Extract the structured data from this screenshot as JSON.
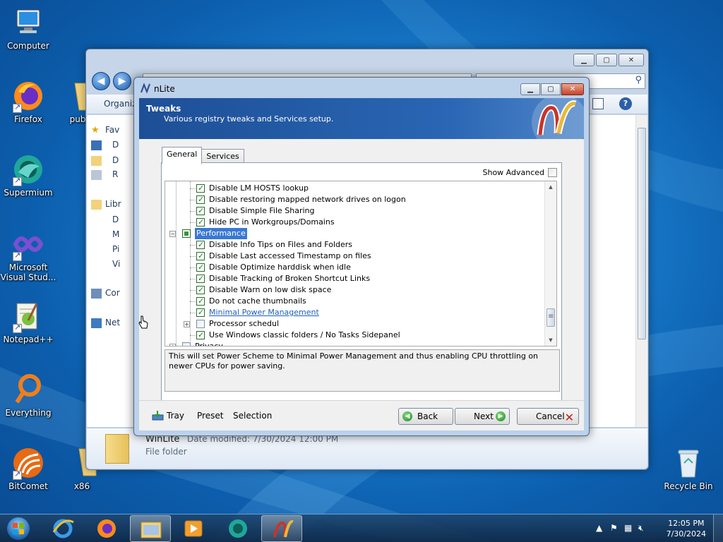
{
  "desktop": {
    "icons": [
      {
        "label": "Computer"
      },
      {
        "label": "Firefox"
      },
      {
        "label": "Supermium"
      },
      {
        "label": "Microsoft Visual Stud..."
      },
      {
        "label": "Notepad++"
      },
      {
        "label": "Everything"
      },
      {
        "label": "BitComet"
      },
      {
        "label": "Recycle Bin"
      },
      {
        "label": "pub"
      },
      {
        "label": "x86"
      }
    ]
  },
  "explorer": {
    "toolbar_organize": "Organiz",
    "nav": {
      "favorites": "Fav",
      "item_d1": "D",
      "item_d2": "D",
      "item_r": "R",
      "libraries": "Libr",
      "lib_d": "D",
      "lib_m": "M",
      "lib_p": "Pi",
      "lib_v": "Vi",
      "computer": "Cor",
      "network": "Net"
    },
    "detail": {
      "name": "WinLite",
      "modified": "Date modified:  7/30/2024 12:00 PM",
      "type": "File folder"
    }
  },
  "nlite": {
    "title": "nLite",
    "header_title": "Tweaks",
    "header_subtitle": "Various registry tweaks and Services setup.",
    "tabs": [
      "General",
      "Services"
    ],
    "show_advanced": "Show Advanced",
    "tree": [
      {
        "label": "Disable LM HOSTS lookup",
        "state": "on"
      },
      {
        "label": "Disable restoring mapped network drives on logon",
        "state": "on"
      },
      {
        "label": "Disable Simple File Sharing",
        "state": "on"
      },
      {
        "label": "Hide PC in Workgroups/Domains",
        "state": "on"
      },
      {
        "label": "Performance",
        "state": "part"
      },
      {
        "label": "Disable Info Tips on Files and Folders",
        "state": "on"
      },
      {
        "label": "Disable Last accessed Timestamp on files",
        "state": "on"
      },
      {
        "label": "Disable Optimize harddisk when idle",
        "state": "on"
      },
      {
        "label": "Disable Tracking of Broken Shortcut Links",
        "state": "on"
      },
      {
        "label": "Disable Warn on low disk space",
        "state": "on"
      },
      {
        "label": "Do not cache thumbnails",
        "state": "on"
      },
      {
        "label": "Minimal Power Management",
        "state": "on"
      },
      {
        "label": "Processor schedul",
        "state": "off"
      },
      {
        "label": "Use Windows classic folders / No Tasks Sidepanel",
        "state": "on"
      },
      {
        "label": "Privacy",
        "state": "off"
      }
    ],
    "description": "This will set Power Scheme to Minimal Power Management and thus enabling CPU throttling on newer CPUs for power saving.",
    "footer": {
      "tray": "Tray",
      "preset": "Preset",
      "selection": "Selection",
      "back": "Back",
      "next": "Next",
      "cancel": "Cancel"
    }
  },
  "taskbar": {
    "time": "12:05 PM",
    "date": "7/30/2024"
  },
  "colors": {
    "header_blue": "#1d4f96",
    "selection_blue": "#3a78d4",
    "check_green": "#1d7a1d"
  }
}
